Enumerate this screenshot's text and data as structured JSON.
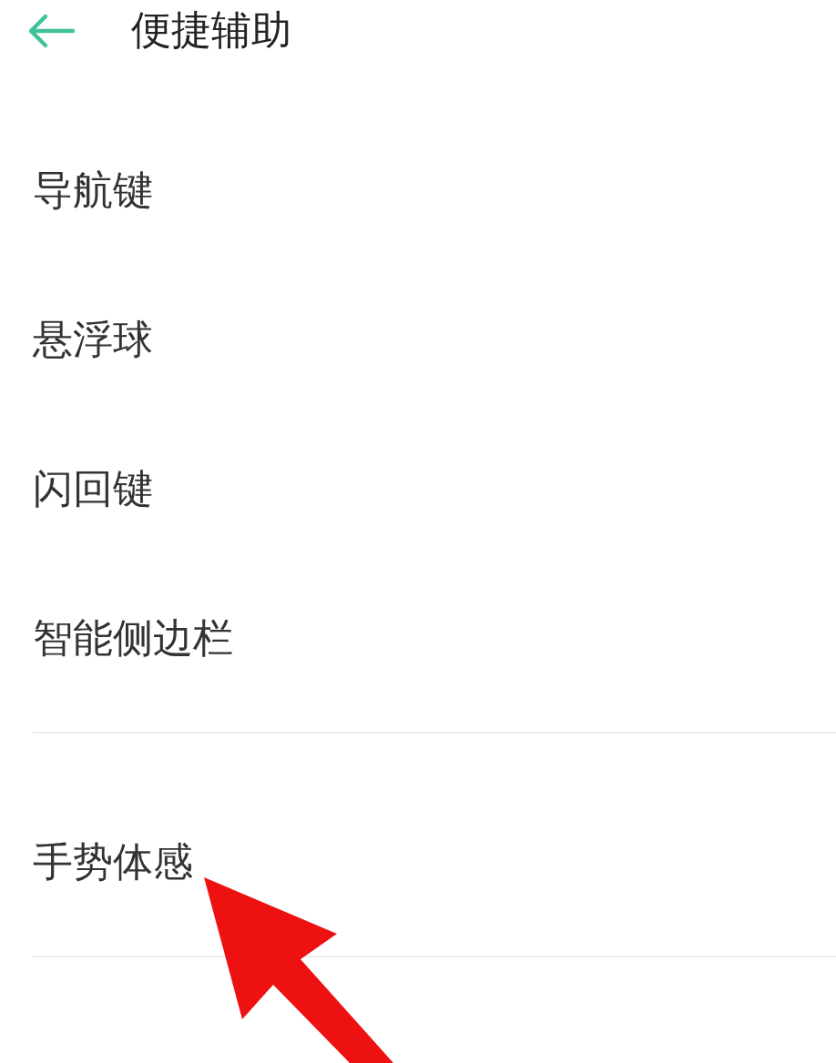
{
  "header": {
    "title": "便捷辅助"
  },
  "sections": [
    {
      "items": [
        "导航键",
        "悬浮球",
        "闪回键",
        "智能侧边栏"
      ]
    },
    {
      "items": [
        "手势体感"
      ]
    }
  ]
}
